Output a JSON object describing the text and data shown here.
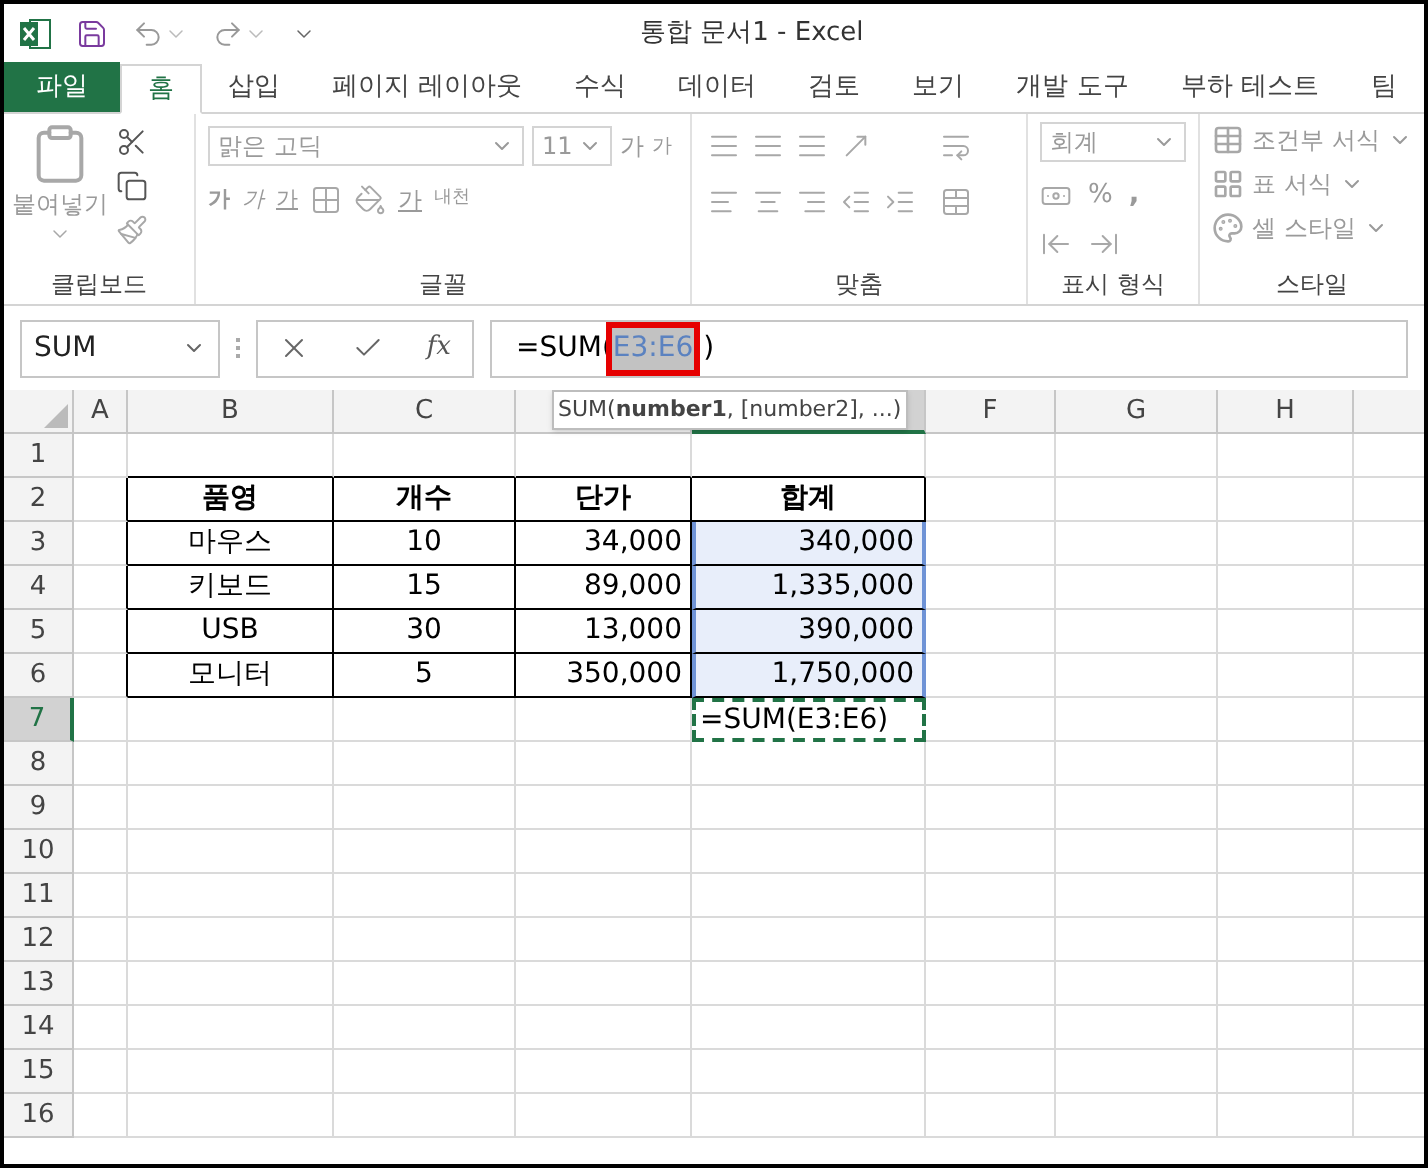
{
  "title_bar": {
    "title": "통합 문서1 - Excel"
  },
  "ribbon_tabs": [
    {
      "label": "파일",
      "kind": "file",
      "selected": false
    },
    {
      "label": "홈",
      "kind": "tab",
      "selected": true
    },
    {
      "label": "삽입",
      "kind": "tab",
      "selected": false
    },
    {
      "label": "페이지 레이아웃",
      "kind": "tab",
      "selected": false
    },
    {
      "label": "수식",
      "kind": "tab",
      "selected": false
    },
    {
      "label": "데이터",
      "kind": "tab",
      "selected": false
    },
    {
      "label": "검토",
      "kind": "tab",
      "selected": false
    },
    {
      "label": "보기",
      "kind": "tab",
      "selected": false
    },
    {
      "label": "개발 도구",
      "kind": "tab",
      "selected": false
    },
    {
      "label": "부하 테스트",
      "kind": "tab",
      "selected": false
    },
    {
      "label": "팀",
      "kind": "tab",
      "selected": false
    }
  ],
  "ribbon": {
    "disabled": true,
    "clipboard": {
      "label": "클립보드",
      "paste": "붙여넣기"
    },
    "font": {
      "label": "글꼴",
      "font_name": "맑은 고딕",
      "font_size": "11",
      "grow": "가",
      "shrink": "가",
      "bold": "가",
      "italic": "가",
      "underline": "가",
      "font_color": "가",
      "phonetic": "내천"
    },
    "alignment": {
      "label": "맞춤"
    },
    "number": {
      "label": "표시 형식",
      "format": "회계",
      "percent": "%",
      "comma": ","
    },
    "styles": {
      "label": "스타일",
      "items": [
        "조건부 서식",
        "표 서식",
        "셀 스타일"
      ]
    }
  },
  "formula_bar": {
    "name_box": "SUM",
    "function_label": "fx",
    "formula": "=SUM(",
    "formula_ref": "E3:E6",
    "formula_end": ")",
    "tooltip": "SUM(**number1**, [number2], ...)"
  },
  "sheet": {
    "columns": [
      {
        "label": "A",
        "selected": false
      },
      {
        "label": "B",
        "selected": false
      },
      {
        "label": "C",
        "selected": false
      },
      {
        "selected": false
      },
      {
        "selected": true
      },
      {
        "label": "F",
        "selected": false
      },
      {
        "label": "G",
        "selected": false
      },
      {
        "label": "H",
        "selected": false
      }
    ],
    "rows": [
      {
        "label": "1",
        "selected": false
      },
      {
        "label": "2",
        "selected": false
      },
      {
        "label": "3",
        "selected": false
      },
      {
        "label": "4",
        "selected": false
      },
      {
        "label": "5",
        "selected": false
      },
      {
        "label": "6",
        "selected": false
      },
      {
        "label": "7",
        "selected": true
      },
      {
        "label": "8",
        "selected": false
      },
      {
        "label": "9",
        "selected": false
      },
      {
        "label": "10",
        "selected": false
      },
      {
        "label": "11",
        "selected": false
      },
      {
        "label": "12",
        "selected": false
      },
      {
        "label": "13",
        "selected": false
      },
      {
        "label": "14",
        "selected": false
      },
      {
        "label": "15",
        "selected": false
      },
      {
        "label": "16",
        "selected": false
      }
    ],
    "table": {
      "header": [
        "품영",
        "개수",
        "단가",
        "합계"
      ],
      "rows": [
        {
          "cells": [
            "마우스",
            "10",
            "34,000",
            "340,000"
          ],
          "referenced": true
        },
        {
          "cells": [
            "키보드",
            "15",
            "89,000",
            "1,335,000"
          ],
          "referenced": true
        },
        {
          "cells": [
            "USB",
            "30",
            "13,000",
            "390,000"
          ],
          "referenced": true
        },
        {
          "cells": [
            "모니터",
            "5",
            "350,000",
            "1,750,000"
          ],
          "referenced": true
        }
      ]
    },
    "active_cell": {
      "value": "=SUM(E3:E6)"
    }
  }
}
